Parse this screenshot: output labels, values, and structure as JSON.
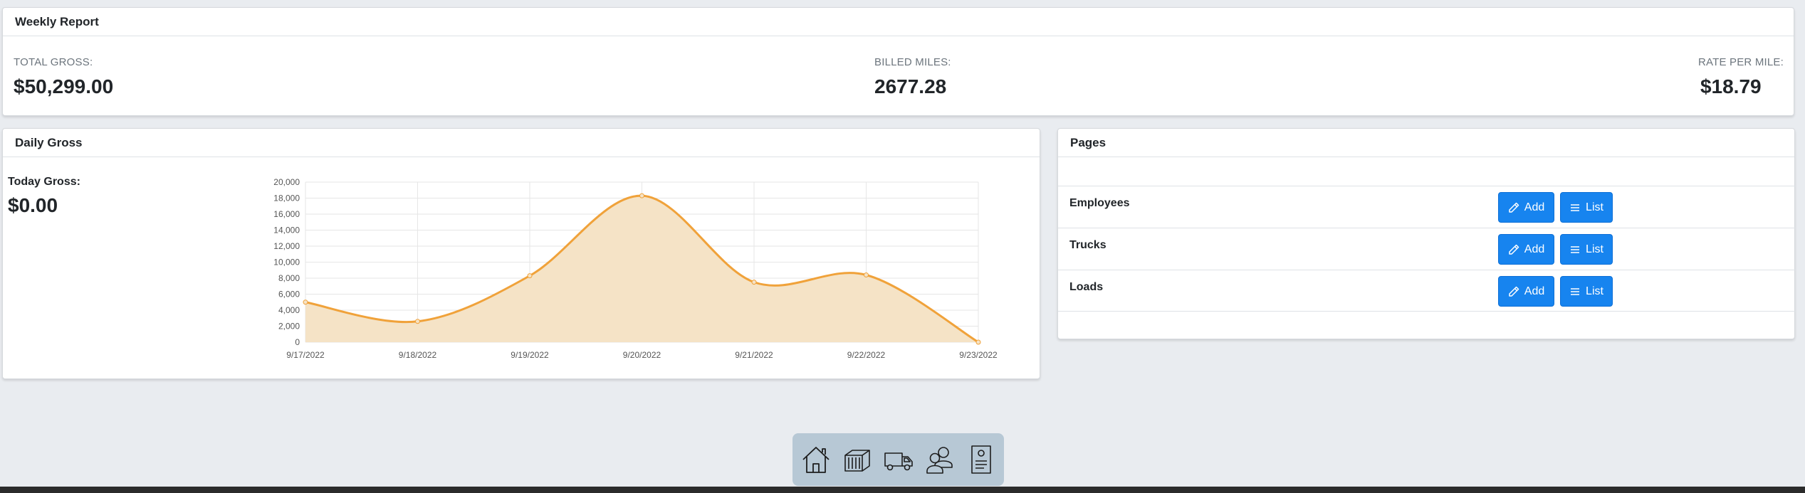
{
  "weekly_report": {
    "title": "Weekly Report",
    "total_gross_label": "TOTAL GROSS:",
    "total_gross_value": "$50,299.00",
    "billed_miles_label": "BILLED MILES:",
    "billed_miles_value": "2677.28",
    "rate_label": "RATE PER MILE:",
    "rate_value": "$18.79"
  },
  "daily_gross": {
    "title": "Daily Gross",
    "today_label": "Today Gross:",
    "today_value": "$0.00"
  },
  "chart_data": {
    "type": "area",
    "x": [
      "9/17/2022",
      "9/18/2022",
      "9/19/2022",
      "9/20/2022",
      "9/21/2022",
      "9/22/2022",
      "9/23/2022"
    ],
    "series": [
      {
        "values": [
          5000,
          2600,
          8300,
          18300,
          7500,
          8400,
          0
        ]
      }
    ],
    "ylim": [
      0,
      20000
    ],
    "yticks": [
      0,
      2000,
      4000,
      6000,
      8000,
      10000,
      12000,
      14000,
      16000,
      18000,
      20000
    ],
    "grid": true,
    "line_color": "#f0a23a",
    "fill_color": "#f5e3c6"
  },
  "pages": {
    "title": "Pages",
    "add_label": "Add",
    "list_label": "List",
    "rows": [
      {
        "name": "Employees"
      },
      {
        "name": "Trucks"
      },
      {
        "name": "Loads"
      }
    ]
  },
  "dock": {
    "items": [
      "home-icon",
      "container-icon",
      "truck-icon",
      "users-icon",
      "document-icon"
    ]
  },
  "colors": {
    "accent": "#1784ef",
    "background": "#e9ecf0"
  }
}
